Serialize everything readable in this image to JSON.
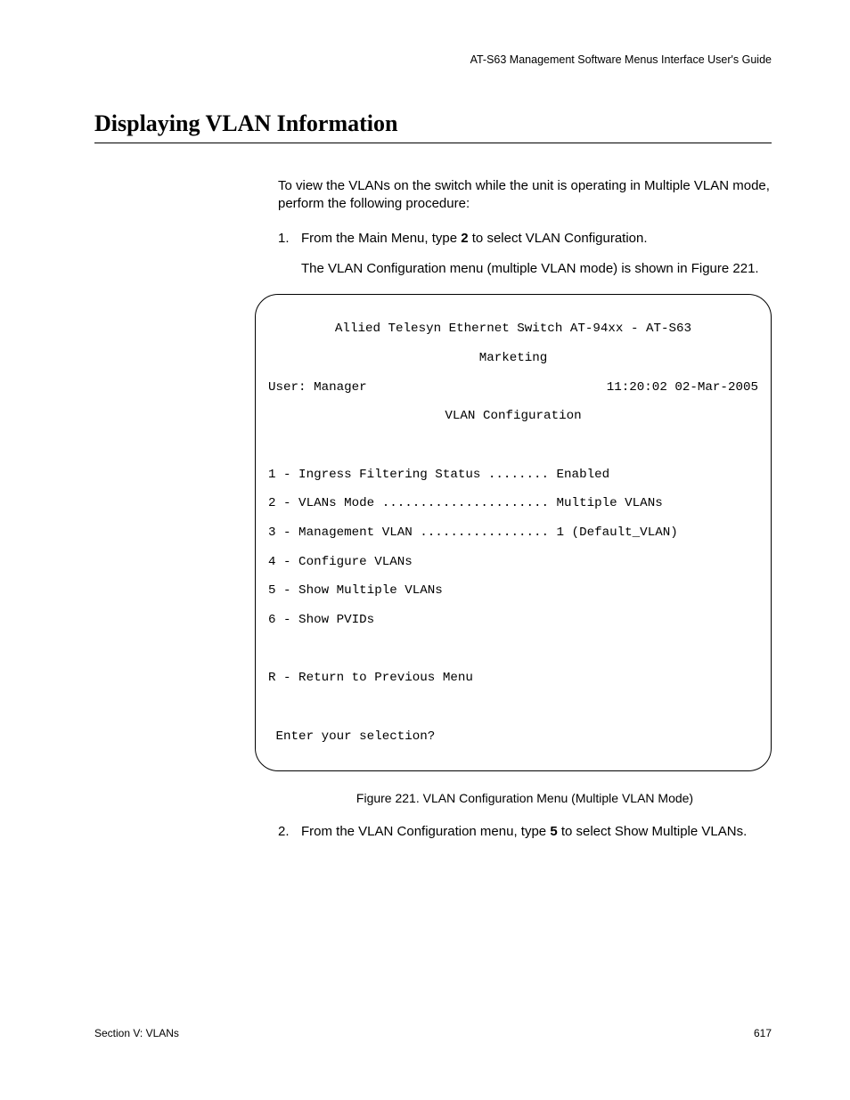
{
  "header": {
    "doc_title": "AT-S63 Management Software Menus Interface User's Guide"
  },
  "title": "Displaying VLAN Information",
  "intro": "To view the VLANs on the switch while the unit is operating in Multiple VLAN mode, perform the following procedure:",
  "step1": {
    "num": "1.",
    "text_a": "From the Main Menu, type ",
    "bold": "2",
    "text_b": " to select VLAN Configuration.",
    "result": "The VLAN Configuration menu (multiple VLAN mode) is shown in Figure 221."
  },
  "terminal": {
    "title": "Allied Telesyn Ethernet Switch AT-94xx - AT-S63",
    "subtitle": "Marketing",
    "user": "User: Manager",
    "timestamp": "11:20:02 02-Mar-2005",
    "section": "VLAN Configuration",
    "line1": "1 - Ingress Filtering Status ........ Enabled",
    "line2": "2 - VLANs Mode ...................... Multiple VLANs",
    "line3": "3 - Management VLAN ................. 1 (Default_VLAN)",
    "line4": "4 - Configure VLANs",
    "line5": "5 - Show Multiple VLANs",
    "line6": "6 - Show PVIDs",
    "line7": "R - Return to Previous Menu",
    "prompt": " Enter your selection?"
  },
  "figure_caption": "Figure 221. VLAN Configuration Menu (Multiple VLAN Mode)",
  "step2": {
    "num": "2.",
    "text_a": "From the VLAN Configuration menu, type ",
    "bold": "5",
    "text_b": " to select Show Multiple VLANs."
  },
  "footer": {
    "section": "Section V: VLANs",
    "page": "617"
  }
}
